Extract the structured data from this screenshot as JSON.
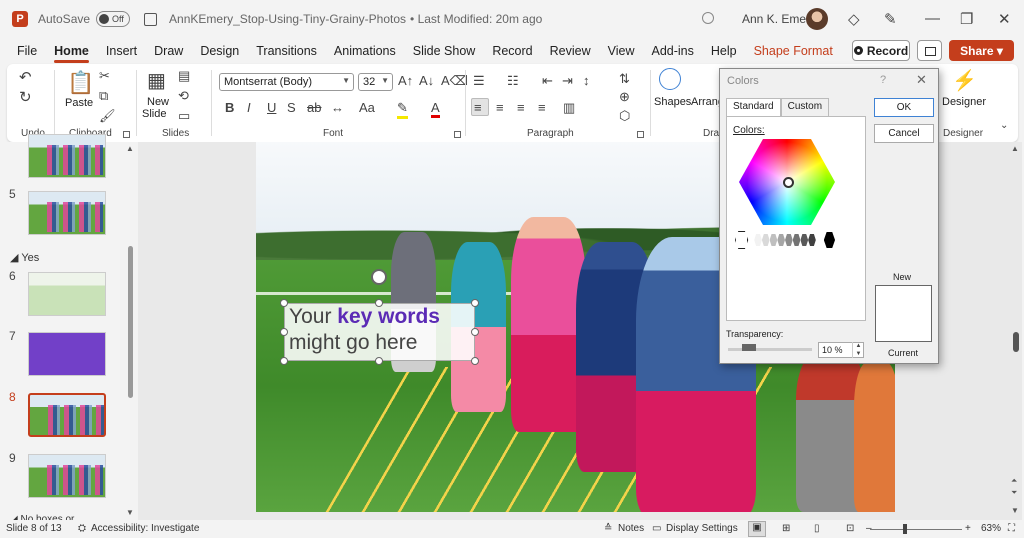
{
  "titlebar": {
    "app_letter": "P",
    "autosave_label": "AutoSave",
    "autosave_state": "Off",
    "document_title": "AnnKEmery_Stop-Using-Tiny-Grainy-Photos",
    "modified": "• Last Modified: 20m ago",
    "user_name": "Ann K. Emery"
  },
  "menu": {
    "tabs": [
      "File",
      "Home",
      "Insert",
      "Draw",
      "Design",
      "Transitions",
      "Animations",
      "Slide Show",
      "Record",
      "Review",
      "View",
      "Add-ins",
      "Help",
      "Shape Format"
    ],
    "record_label": "Record",
    "share_label": "Share"
  },
  "ribbon": {
    "undo_group": "Undo",
    "clipboard_group": "Clipboard",
    "paste_label": "Paste",
    "slides_group": "Slides",
    "new_slide_label": "New",
    "new_slide_label2": "Slide",
    "font_group": "Font",
    "font_name": "Montserrat (Body)",
    "font_size": "32",
    "paragraph_group": "Paragraph",
    "shapes_label": "Shapes",
    "arrange_label": "Arrang",
    "drawing_group": "Draw",
    "designer_label": "Designer",
    "designer_group": "Designer",
    "bold": "B",
    "italic": "I",
    "underline": "U",
    "strike": "S",
    "char_spacing": "ab",
    "change_case": "Aa",
    "font_color": "A"
  },
  "thumbnails": {
    "slides": [
      {
        "num": "5",
        "style": "photo"
      },
      {
        "num": "6",
        "style": "faded"
      },
      {
        "num": "7",
        "style": "purple"
      },
      {
        "num": "8",
        "style": "photo"
      },
      {
        "num": "9",
        "style": "photo"
      }
    ],
    "section_yes": "Yes",
    "section_cut": "No boxes or ..."
  },
  "slide": {
    "text_line1_prefix": "Your ",
    "text_line1_keyword": "key words",
    "text_line2": "might go here"
  },
  "colors_dialog": {
    "title": "Colors",
    "help": "?",
    "tab_standard": "Standard",
    "tab_custom": "Custom",
    "colors_label": "Colors:",
    "ok": "OK",
    "cancel": "Cancel",
    "new_label": "New",
    "current_label": "Current",
    "transparency_label": "Transparency:",
    "transparency_value": "10 %",
    "preview_color": "#ffffff"
  },
  "statusbar": {
    "slide_counter": "Slide 8 of 13",
    "accessibility": "Accessibility: Investigate",
    "notes": "Notes",
    "display_settings": "Display Settings",
    "zoom_minus": "–",
    "zoom_plus": "+",
    "zoom": "63%"
  },
  "colors": {
    "accent": "#c43e1c",
    "keyword": "#5b2bb5"
  }
}
